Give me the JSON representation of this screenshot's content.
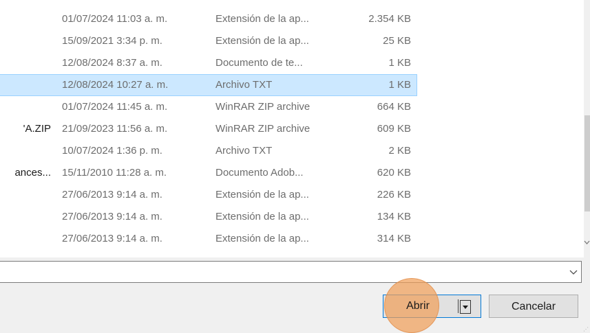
{
  "file_list": {
    "rows": [
      {
        "name": "",
        "date": "01/07/2024 11:03 a. m.",
        "type": "Extensión de la ap...",
        "size": "2.354 KB"
      },
      {
        "name": "",
        "date": "15/09/2021 3:34 p. m.",
        "type": "Extensión de la ap...",
        "size": "25 KB"
      },
      {
        "name": "",
        "date": "12/08/2024 8:37 a. m.",
        "type": "Documento de te...",
        "size": "1 KB"
      },
      {
        "name": "",
        "date": "12/08/2024 10:27 a. m.",
        "type": "Archivo TXT",
        "size": "1 KB"
      },
      {
        "name": "",
        "date": "01/07/2024 11:45 a. m.",
        "type": "WinRAR ZIP archive",
        "size": "664 KB"
      },
      {
        "name": "'A.ZIP",
        "date": "21/09/2023 11:56 a. m.",
        "type": "WinRAR ZIP archive",
        "size": "609 KB"
      },
      {
        "name": "",
        "date": "10/07/2024 1:36 p. m.",
        "type": "Archivo TXT",
        "size": "2 KB"
      },
      {
        "name": "ances...",
        "date": "15/11/2010 11:28 a. m.",
        "type": "Documento Adob...",
        "size": "620 KB"
      },
      {
        "name": "",
        "date": "27/06/2013 9:14 a. m.",
        "type": "Extensión de la ap...",
        "size": "226 KB"
      },
      {
        "name": "",
        "date": "27/06/2013 9:14 a. m.",
        "type": "Extensión de la ap...",
        "size": "134 KB"
      },
      {
        "name": "",
        "date": "27/06/2013 9:14 a. m.",
        "type": "Extensión de la ap...",
        "size": "314 KB"
      }
    ],
    "selected_row": 4
  },
  "filename_field": {
    "value": ""
  },
  "buttons": {
    "open_label": "Abrir",
    "cancel_label": "Cancelar"
  },
  "colors": {
    "selection": "#cce8ff",
    "highlight": "#f0a05a",
    "primary_border": "#0078d7"
  }
}
